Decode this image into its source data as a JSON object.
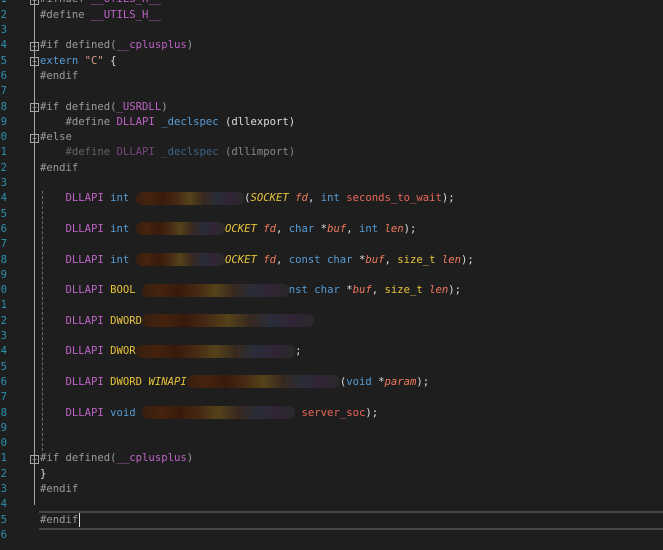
{
  "editor": {
    "line_numbers": [
      1,
      2,
      3,
      4,
      5,
      6,
      7,
      8,
      9,
      10,
      11,
      12,
      13,
      14,
      15,
      16,
      17,
      18,
      19,
      20,
      21,
      22,
      23,
      24,
      25,
      26,
      27,
      28,
      29,
      30,
      31,
      32,
      33,
      34,
      35,
      36
    ],
    "lines": {
      "l1": [
        {
          "t": "#ifndef ",
          "c": "pp"
        },
        {
          "t": "__UTILS_H__",
          "c": "mac"
        }
      ],
      "l2": [
        {
          "t": "#define ",
          "c": "pp"
        },
        {
          "t": "__UTILS_H__",
          "c": "mac"
        }
      ],
      "l4": [
        {
          "t": "#if defined(",
          "c": "pp"
        },
        {
          "t": "__cplusplus",
          "c": "mac"
        },
        {
          "t": ")",
          "c": "pp"
        }
      ],
      "l5": [
        {
          "t": "extern ",
          "c": "kw"
        },
        {
          "t": "\"C\"",
          "c": "str"
        },
        {
          "t": " {",
          "c": ""
        }
      ],
      "l6": [
        {
          "t": "#endif",
          "c": "pp"
        }
      ],
      "l8": [
        {
          "t": "#if defined(",
          "c": "pp"
        },
        {
          "t": "_USRDLL",
          "c": "mac"
        },
        {
          "t": ")",
          "c": "pp"
        }
      ],
      "l9": [
        {
          "t": "    #define ",
          "c": "pp"
        },
        {
          "t": "DLLAPI",
          "c": "mac"
        },
        {
          "t": " _declspec",
          "c": "kw"
        },
        {
          "t": " (dllexport)",
          "c": ""
        }
      ],
      "l10": [
        {
          "t": "#else",
          "c": "pp"
        }
      ],
      "l11": [
        {
          "t": "    #define ",
          "c": "pp dim"
        },
        {
          "t": "DLLAPI",
          "c": "mac dim"
        },
        {
          "t": " _declspec",
          "c": "kw dim"
        },
        {
          "t": " (dllimport)",
          "c": "dim"
        }
      ],
      "l12": [
        {
          "t": "#endif",
          "c": "pp"
        }
      ],
      "l14": [
        {
          "t": "    DLLAPI",
          "c": "mac"
        },
        {
          "t": " int ",
          "c": "kw"
        },
        {
          "blur": 17
        },
        {
          "t": "(",
          "c": ""
        },
        {
          "t": "SOCKET",
          "c": "tyi"
        },
        {
          "t": " fd",
          "c": "par"
        },
        {
          "t": ", ",
          "c": ""
        },
        {
          "t": "int",
          "c": "kw"
        },
        {
          "t": " seconds_to_wait",
          "c": "fn"
        },
        {
          "t": ");",
          "c": ""
        }
      ],
      "l16": [
        {
          "t": "    DLLAPI",
          "c": "mac"
        },
        {
          "t": " int ",
          "c": "kw"
        },
        {
          "blur": 14
        },
        {
          "t": "OCKET",
          "c": "tyi"
        },
        {
          "t": " fd",
          "c": "par"
        },
        {
          "t": ", ",
          "c": ""
        },
        {
          "t": "char",
          "c": "kw"
        },
        {
          "t": " *",
          "c": ""
        },
        {
          "t": "buf",
          "c": "par"
        },
        {
          "t": ", ",
          "c": ""
        },
        {
          "t": "int",
          "c": "kw"
        },
        {
          "t": " len",
          "c": "par"
        },
        {
          "t": ");",
          "c": ""
        }
      ],
      "l18": [
        {
          "t": "    DLLAPI",
          "c": "mac"
        },
        {
          "t": " int ",
          "c": "kw"
        },
        {
          "blur": 14
        },
        {
          "t": "OCKET",
          "c": "tyi"
        },
        {
          "t": " fd",
          "c": "par"
        },
        {
          "t": ", ",
          "c": ""
        },
        {
          "t": "const char",
          "c": "kw"
        },
        {
          "t": " *",
          "c": ""
        },
        {
          "t": "buf",
          "c": "par"
        },
        {
          "t": ", ",
          "c": ""
        },
        {
          "t": "size_t",
          "c": "ty"
        },
        {
          "t": " len",
          "c": "par"
        },
        {
          "t": ");",
          "c": ""
        }
      ],
      "l20": [
        {
          "t": "    DLLAPI",
          "c": "mac"
        },
        {
          "t": " BOOL ",
          "c": "ty"
        },
        {
          "blur": 23
        },
        {
          "t": "nst char",
          "c": "kw"
        },
        {
          "t": " *",
          "c": ""
        },
        {
          "t": "buf",
          "c": "par"
        },
        {
          "t": ", ",
          "c": ""
        },
        {
          "t": "size_t",
          "c": "ty"
        },
        {
          "t": " len",
          "c": "par"
        },
        {
          "t": ");",
          "c": ""
        }
      ],
      "l22": [
        {
          "t": "    DLLAPI",
          "c": "mac"
        },
        {
          "t": " DWORD",
          "c": "ty"
        },
        {
          "blur": 27
        }
      ],
      "l24": [
        {
          "t": "    DLLAPI",
          "c": "mac"
        },
        {
          "t": " DWOR",
          "c": "ty"
        },
        {
          "blur": 25
        },
        {
          "t": ";",
          "c": ""
        }
      ],
      "l26": [
        {
          "t": "    DLLAPI",
          "c": "mac"
        },
        {
          "t": " DWORD ",
          "c": "ty"
        },
        {
          "t": "WINAPI",
          "c": "tyi"
        },
        {
          "blur": 24
        },
        {
          "t": "(",
          "c": ""
        },
        {
          "t": "void",
          "c": "kw"
        },
        {
          "t": " *",
          "c": ""
        },
        {
          "t": "param",
          "c": "par"
        },
        {
          "t": ");",
          "c": ""
        }
      ],
      "l28": [
        {
          "t": "    DLLAPI",
          "c": "mac"
        },
        {
          "t": " void ",
          "c": "kw"
        },
        {
          "blur": 24
        },
        {
          "t": " server_soc",
          "c": "fn"
        },
        {
          "t": ");",
          "c": ""
        }
      ],
      "l31": [
        {
          "t": "#if defined(",
          "c": "pp"
        },
        {
          "t": "__cplusplus",
          "c": "mac"
        },
        {
          "t": ")",
          "c": "pp"
        }
      ],
      "l32": [
        {
          "t": "}",
          "c": ""
        }
      ],
      "l33": [
        {
          "t": "#endif",
          "c": "pp"
        }
      ],
      "l35": [
        {
          "t": "#endif",
          "c": "pp"
        }
      ]
    },
    "fold_icon": "minus-box-icon",
    "colors": {
      "background": "#1e1e1e",
      "line_number": "#2b91af",
      "macro": "#bd63c5",
      "keyword": "#569cd6",
      "preprocessor": "#9b9b9b"
    }
  }
}
